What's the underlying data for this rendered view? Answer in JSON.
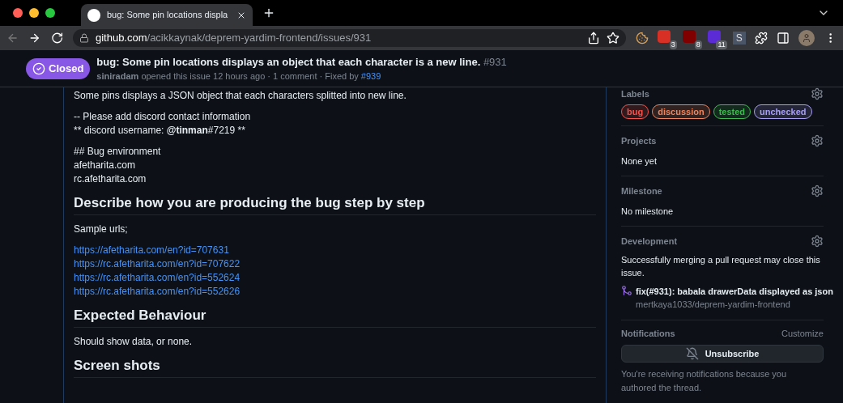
{
  "tab": {
    "title": "bug: Some pin locations displa",
    "selected": true
  },
  "address": {
    "host": "github.com",
    "path": "/acikkaynak/deprem-yardim-frontend/issues/931"
  },
  "extensions": [
    {
      "kind": "cookie"
    },
    {
      "kind": "badge",
      "color": "#d93025",
      "badge": "3"
    },
    {
      "kind": "badge",
      "color": "#800000",
      "badge": "8"
    },
    {
      "kind": "badge",
      "color": "#5b2bd6",
      "badge": "11"
    },
    {
      "kind": "letter",
      "text": "S"
    },
    {
      "kind": "puzzle"
    },
    {
      "kind": "sidebar"
    },
    {
      "kind": "avatar"
    }
  ],
  "issue": {
    "state": "Closed",
    "title": "bug: Some pin locations displays an object that each character is a new line.",
    "number": "#931",
    "author": "siniradam",
    "meta": "opened this issue 12 hours ago · 1 comment · Fixed by",
    "fixed_by": "#939"
  },
  "body": [
    {
      "kind": "p",
      "lines": [
        "Some pins displays a JSON object that each characters splitted into new line."
      ]
    },
    {
      "kind": "p",
      "lines": [
        "-- Please add discord contact information",
        "** discord username: **@tinman**#7219 **"
      ]
    },
    {
      "kind": "p",
      "lines": [
        "## Bug environment",
        "afetharita.com",
        "rc.afetharita.com"
      ]
    },
    {
      "kind": "h",
      "text": "Describe how you are producing the bug step by step"
    },
    {
      "kind": "p",
      "lines": [
        "Sample urls;"
      ]
    },
    {
      "kind": "links",
      "lines": [
        "https://afetharita.com/en?id=707631",
        "https://rc.afetharita.com/en?id=707622",
        "https://rc.afetharita.com/en?id=552624",
        "https://rc.afetharita.com/en?id=552626"
      ]
    },
    {
      "kind": "h",
      "text": "Expected Behaviour"
    },
    {
      "kind": "p",
      "lines": [
        "Should show data, or none."
      ]
    },
    {
      "kind": "h",
      "text": "Screen shots"
    }
  ],
  "sidebar": {
    "labels_heading": "Labels",
    "labels": [
      {
        "name": "bug",
        "color": "#f85149"
      },
      {
        "name": "discussion",
        "color": "#f0845c"
      },
      {
        "name": "tested",
        "color": "#3fb950"
      },
      {
        "name": "unchecked",
        "color": "#a89ff5"
      }
    ],
    "sections": [
      {
        "heading": "Projects",
        "value": "None yet"
      },
      {
        "heading": "Milestone",
        "value": "No milestone"
      }
    ],
    "development": {
      "heading": "Development",
      "note": "Successfully merging a pull request may close this issue.",
      "pr_title": "fix(#931): babala drawerData displayed as json",
      "pr_repo": "mertkaya1033/deprem-yardim-frontend"
    },
    "notifications": {
      "heading": "Notifications",
      "customize": "Customize",
      "button": "Unsubscribe",
      "note": "You're receiving notifications because you authored the thread."
    }
  }
}
